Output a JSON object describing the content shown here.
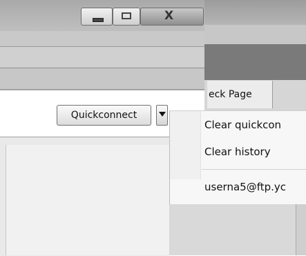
{
  "window": {
    "minimize_icon": "minimize-icon",
    "maximize_icon": "maximize-icon",
    "close_icon": "close-icon",
    "close_glyph": "X"
  },
  "toolbar": {
    "quickconnect_label": "Quickconnect",
    "dropdown_icon": "dropdown-arrow-icon"
  },
  "background_window": {
    "tab_label": "eck Page"
  },
  "dropdown_menu": {
    "items": [
      {
        "label": "Clear quickcon"
      },
      {
        "label": "Clear history"
      },
      {
        "label": "userna5@ftp.yc"
      }
    ]
  }
}
